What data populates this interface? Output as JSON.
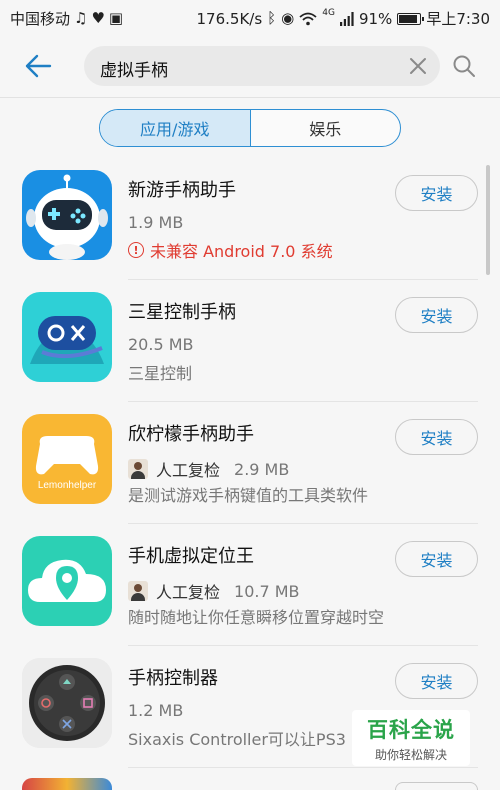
{
  "status_bar": {
    "carrier": "中国移动",
    "speed": "176.5K/s",
    "network": "4G",
    "battery": "91%",
    "battery_level": 0.91,
    "time": "早上7:30"
  },
  "search": {
    "query": "虚拟手柄"
  },
  "tabs": [
    {
      "label": "应用/游戏",
      "active": true
    },
    {
      "label": "娱乐",
      "active": false
    }
  ],
  "apps": [
    {
      "name": "新游手柄助手",
      "size": "1.9 MB",
      "desc": "未兼容 Android 7.0 系统",
      "warning": true,
      "install_label": "安装"
    },
    {
      "name": "三星控制手柄",
      "size": "20.5 MB",
      "desc": "三星控制",
      "warning": false,
      "install_label": "安装"
    },
    {
      "name": "欣柠檬手柄助手",
      "review": "人工复检",
      "size": "2.9 MB",
      "desc": "是测试游戏手柄键值的工具类软件",
      "install_label": "安装",
      "icon_text": "Lemonhelper"
    },
    {
      "name": "手机虚拟定位王",
      "review": "人工复检",
      "size": "10.7 MB",
      "desc": "随时随地让你任意瞬移位置穿越时空",
      "install_label": "安装"
    },
    {
      "name": "手柄控制器",
      "size": "1.2 MB",
      "desc": "Sixaxis Controller可以让PS3",
      "install_label": "安装"
    }
  ],
  "watermark": {
    "title": "百科全说",
    "subtitle": "助你轻松解决"
  },
  "colors": {
    "accent": "#1f7fc4",
    "warning": "#e03c31"
  }
}
